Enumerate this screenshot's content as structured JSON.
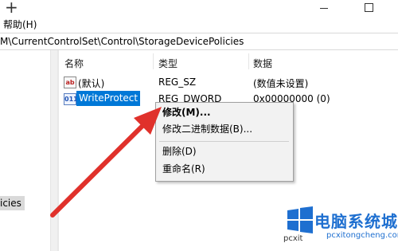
{
  "menu": {
    "help": "帮助(H)"
  },
  "address": {
    "path": "M\\CurrentControlSet\\Control\\StorageDevicePolicies"
  },
  "tree": {
    "selected_item": "icies"
  },
  "columns": {
    "name": "名称",
    "type": "类型",
    "data": "数据"
  },
  "rows": [
    {
      "icon": "ab",
      "name": "(默认)",
      "type": "REG_SZ",
      "data": "(数值未设置)"
    },
    {
      "icon": "011",
      "name": "WriteProtect",
      "type": "REG_DWORD",
      "data": "0x00000000 (0)"
    }
  ],
  "context_menu": {
    "modify": "修改(M)...",
    "modify_binary": "修改二进制数据(B)...",
    "delete": "删除(D)",
    "rename": "重命名(R)"
  },
  "watermark": {
    "title": "电脑系统城",
    "url": "pcxitongcheng.com",
    "url_prefix": "pcxit"
  },
  "colors": {
    "selection": "#0078d7",
    "arrow": "#e0312b",
    "watermark": "#1e6fd0"
  }
}
